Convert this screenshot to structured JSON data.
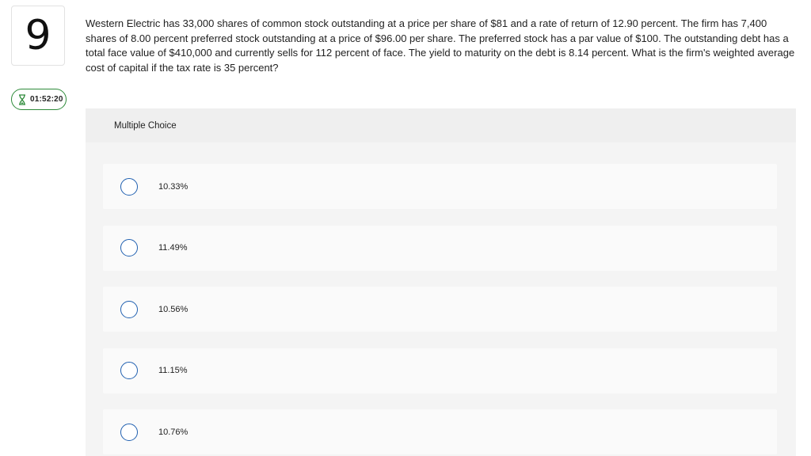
{
  "question_number": "9",
  "timer": {
    "icon": "hourglass-icon",
    "value": "01:52:20",
    "accent_color": "#2e8b3a"
  },
  "question_text": "Western Electric has 33,000 shares of common stock outstanding at a price per share of $81 and a rate of return of 12.90 percent. The firm has 7,400 shares of 8.00 percent preferred stock outstanding at a price of $96.00 per share. The preferred stock has a par value of $100. The outstanding debt has a total face value of $410,000 and currently sells for 112 percent of face. The yield to maturity on the debt is 8.14 percent. What is the firm's weighted average cost of capital if the tax rate is 35 percent?",
  "multiple_choice": {
    "header": "Multiple Choice",
    "radio_color": "#1f5fb0",
    "choices": [
      {
        "label": "10.33%"
      },
      {
        "label": "11.49%"
      },
      {
        "label": "10.56%"
      },
      {
        "label": "11.15%"
      },
      {
        "label": "10.76%"
      }
    ]
  }
}
